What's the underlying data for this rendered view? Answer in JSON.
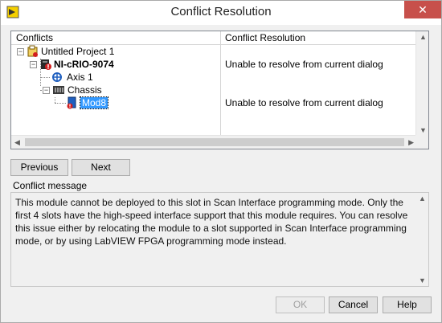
{
  "window": {
    "title": "Conflict Resolution",
    "close_glyph": "✕"
  },
  "tree": {
    "headers": {
      "conflicts": "Conflicts",
      "resolution": "Conflict Resolution"
    },
    "rows": [
      {
        "label": "Untitled Project 1",
        "status": "",
        "icon": "project-icon"
      },
      {
        "label": "NI-cRIO-9074",
        "status": "Unable to resolve from current dialog",
        "icon": "crio-target-error-icon"
      },
      {
        "label": "Axis 1",
        "status": "",
        "icon": "axis-icon"
      },
      {
        "label": "Chassis",
        "status": "",
        "icon": "chassis-icon"
      },
      {
        "label": "Mod8",
        "status": "Unable to resolve from current dialog",
        "icon": "module-error-icon"
      }
    ]
  },
  "buttons": {
    "previous": "Previous",
    "next": "Next",
    "ok": "OK",
    "cancel": "Cancel",
    "help": "Help"
  },
  "message": {
    "label": "Conflict message",
    "text": "This module cannot be deployed to this slot in Scan Interface programming mode.  Only the first 4 slots have the high-speed interface support that this module requires.  You can resolve this issue either by relocating the module to a slot supported in Scan Interface programming mode, or by using LabVIEW FPGA programming mode instead."
  },
  "colors": {
    "selection": "#3399ff",
    "close_button": "#c7504b",
    "error_badge": "#d21e1e"
  }
}
